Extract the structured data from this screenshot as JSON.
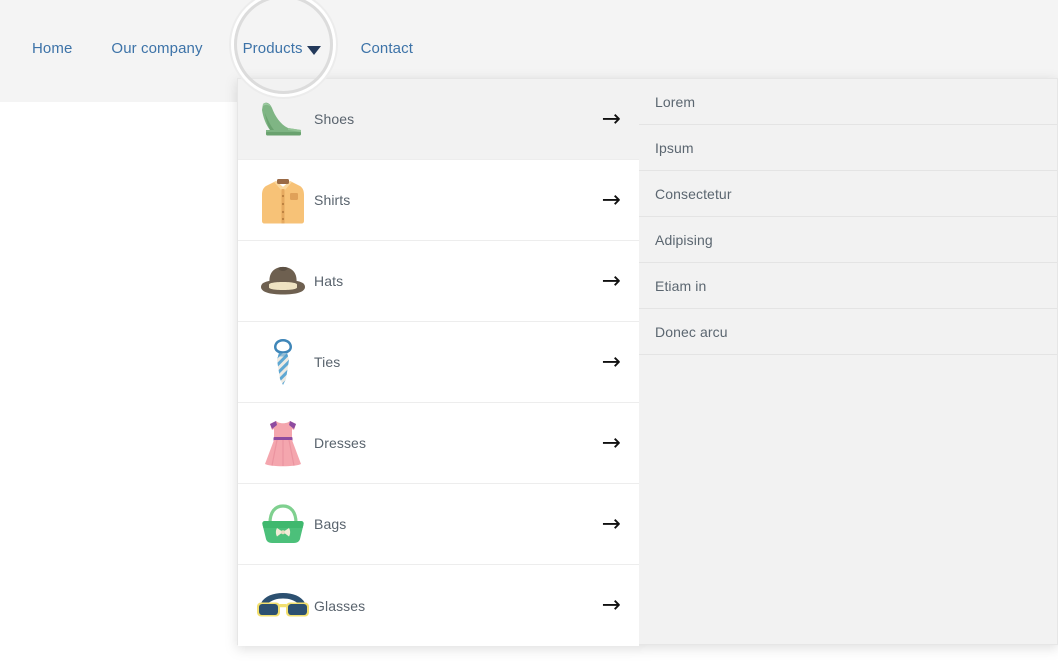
{
  "site": {
    "nav": [
      {
        "label": "Home",
        "name": "nav-home",
        "class": "home"
      },
      {
        "label": "Our company",
        "name": "nav-our-company",
        "class": "company"
      },
      {
        "label": "Products",
        "name": "nav-products",
        "class": "products"
      },
      {
        "label": "Contact",
        "name": "nav-contact",
        "class": "contact"
      }
    ],
    "nav_labels": {
      "home": "Home",
      "company": "Our company",
      "products": "Products",
      "contact": "Contact"
    }
  },
  "menu": {
    "categories": [
      {
        "label": "Shoes",
        "icon": "high-heel-shoe-icon",
        "active": true
      },
      {
        "label": "Shirts",
        "icon": "shirt-icon",
        "active": false
      },
      {
        "label": "Hats",
        "icon": "fedora-hat-icon",
        "active": false
      },
      {
        "label": "Ties",
        "icon": "necktie-icon",
        "active": false
      },
      {
        "label": "Dresses",
        "icon": "dress-icon",
        "active": false
      },
      {
        "label": "Bags",
        "icon": "handbag-icon",
        "active": false
      },
      {
        "label": "Glasses",
        "icon": "sunglasses-icon",
        "active": false
      }
    ],
    "arrow_glyph": "→",
    "submenu": [
      {
        "label": "Lorem"
      },
      {
        "label": "Ipsum"
      },
      {
        "label": "Consectetur"
      },
      {
        "label": "Adipising"
      },
      {
        "label": "Etiam in"
      },
      {
        "label": "Donec arcu"
      }
    ]
  },
  "colors": {
    "nav_link": "#3d73a8",
    "caret": "#23395b",
    "header_bg": "#f4f4f4",
    "panel_bg": "#ffffff",
    "submenu_bg": "#f2f2f2",
    "active_row": "#f2f2f2",
    "label_text": "#59636d"
  }
}
